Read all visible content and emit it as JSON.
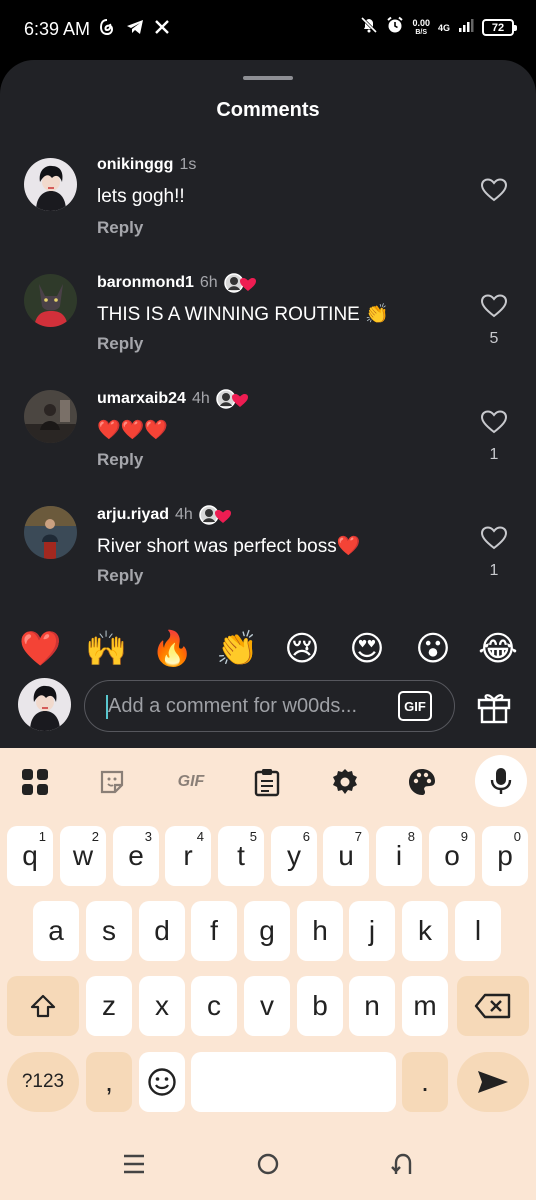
{
  "status_bar": {
    "time": "6:39 AM",
    "net_speed": "0.00",
    "net_unit": "B/S",
    "network": "4G",
    "battery": "72"
  },
  "sheet": {
    "title": "Comments"
  },
  "comments": [
    {
      "username": "onikinggg",
      "time": "1s",
      "text": "lets gogh!!",
      "reply": "Reply",
      "likes": "",
      "creator_liked": false
    },
    {
      "username": "baronmond1",
      "time": "6h",
      "text": "THIS IS A WINNING ROUTINE 👏",
      "reply": "Reply",
      "likes": "5",
      "creator_liked": true
    },
    {
      "username": "umarxaib24",
      "time": "4h",
      "text": "❤️❤️❤️",
      "reply": "Reply",
      "likes": "1",
      "creator_liked": true
    },
    {
      "username": "arju.riyad",
      "time": "4h",
      "text": "River short was perfect boss❤️",
      "reply": "Reply",
      "likes": "1",
      "creator_liked": true
    }
  ],
  "quick_emojis": [
    "❤️",
    "🙌",
    "🔥",
    "👏",
    "😢",
    "😍",
    "😮",
    "😂"
  ],
  "composer": {
    "placeholder": "Add a comment for w00ds...",
    "gif_label": "GIF"
  },
  "keyboard": {
    "toolbar": [
      "apps-icon",
      "sticker-icon",
      "gif-icon",
      "clipboard-icon",
      "settings-icon",
      "palette-icon",
      "mic-icon"
    ],
    "toolbar_gif": "GIF",
    "row1": [
      {
        "k": "q",
        "n": "1"
      },
      {
        "k": "w",
        "n": "2"
      },
      {
        "k": "e",
        "n": "3"
      },
      {
        "k": "r",
        "n": "4"
      },
      {
        "k": "t",
        "n": "5"
      },
      {
        "k": "y",
        "n": "6"
      },
      {
        "k": "u",
        "n": "7"
      },
      {
        "k": "i",
        "n": "8"
      },
      {
        "k": "o",
        "n": "9"
      },
      {
        "k": "p",
        "n": "0"
      }
    ],
    "row2": [
      "a",
      "s",
      "d",
      "f",
      "g",
      "h",
      "j",
      "k",
      "l"
    ],
    "row3": [
      "z",
      "x",
      "c",
      "v",
      "b",
      "n",
      "m"
    ],
    "symbols_label": "?123",
    "comma": ",",
    "period": "."
  },
  "colors": {
    "sheet_bg": "#212226",
    "keyboard_bg": "#fbe6d4",
    "special_key": "#f6d9b8",
    "cursor": "#59c7cf"
  }
}
